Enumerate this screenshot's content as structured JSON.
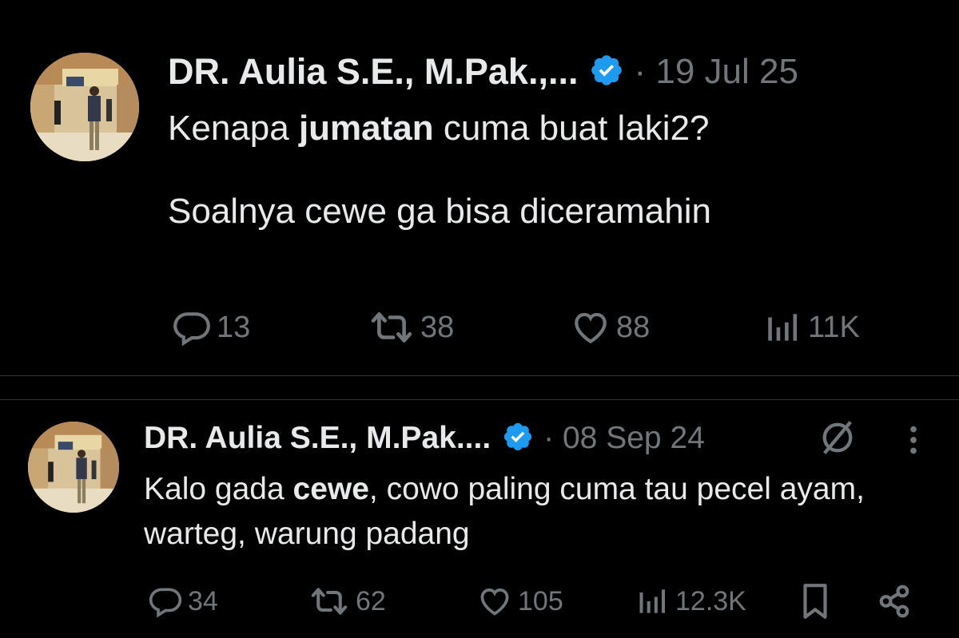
{
  "tweets": [
    {
      "author": "DR. Aulia S.E., M.Pak.,...",
      "date": "· 19 Jul 25",
      "text_parts": [
        "Kenapa ",
        "jumatan",
        " cuma buat laki2?\n\nSoalnya cewe ga bisa diceramahin"
      ],
      "replies": "13",
      "reposts": "38",
      "likes": "88",
      "views": "11K"
    },
    {
      "author": "DR. Aulia S.E., M.Pak....",
      "date": "· 08 Sep 24",
      "text_parts": [
        "Kalo gada ",
        "cewe",
        ", cowo paling cuma tau pecel ayam, warteg, warung padang"
      ],
      "replies": "34",
      "reposts": "62",
      "likes": "105",
      "views": "12.3K"
    }
  ],
  "icons": {
    "reply": "reply-icon",
    "repost": "repost-icon",
    "like": "heart-icon",
    "views": "views-icon",
    "bookmark": "bookmark-icon",
    "share": "share-icon",
    "more": "more-icon",
    "hide": "slash-circle-icon",
    "verified": "verified-badge-icon"
  },
  "colors": {
    "background": "#000000",
    "text": "#e7e9ea",
    "muted": "#71767b",
    "verified": "#1d9bf0"
  }
}
